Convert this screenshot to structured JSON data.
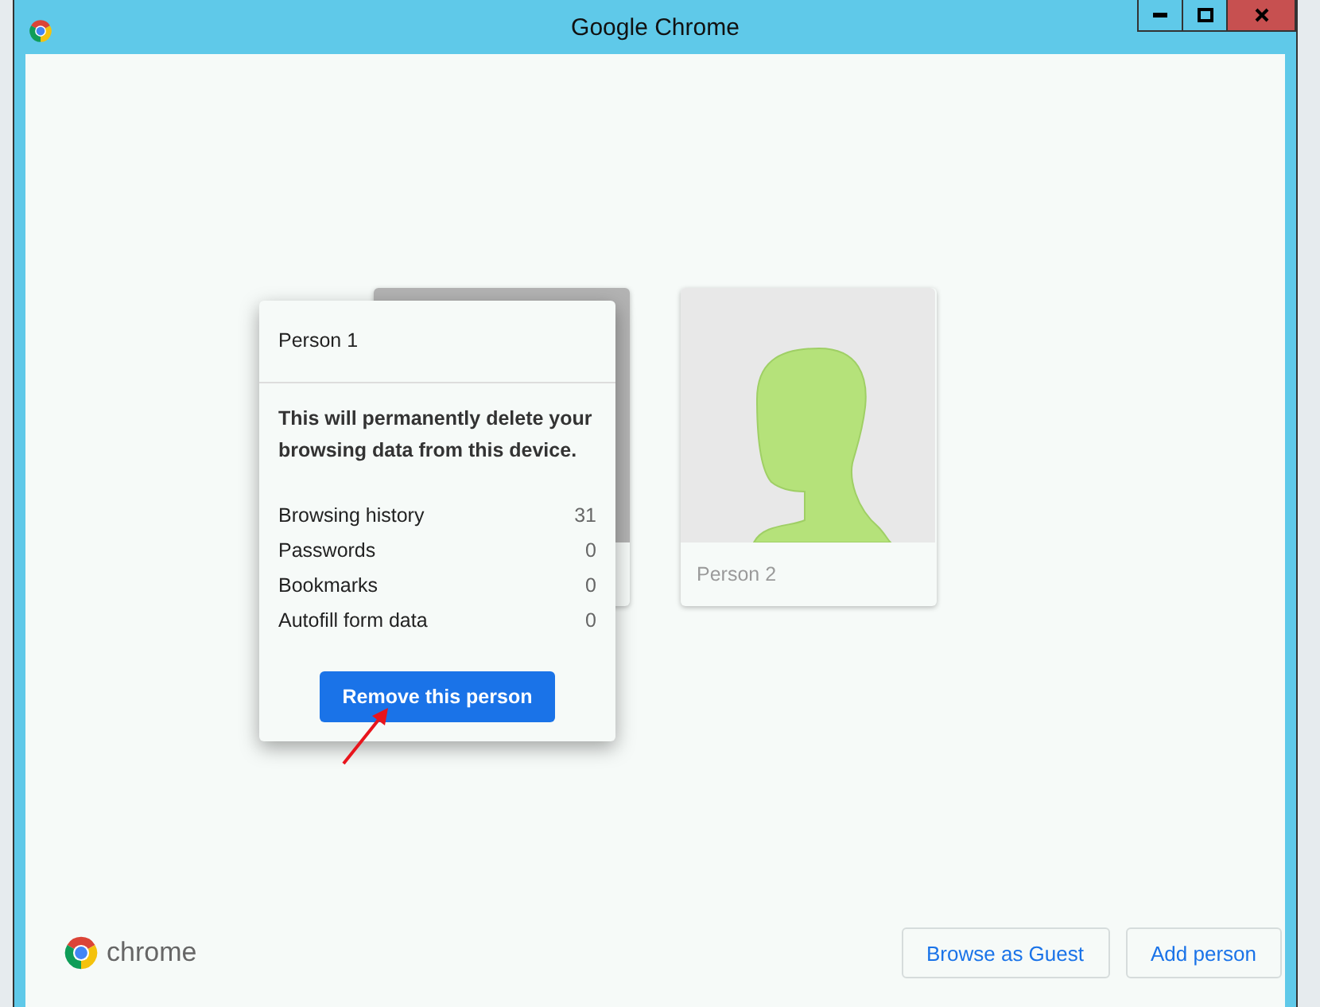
{
  "window": {
    "title": "Google Chrome"
  },
  "profiles": [
    {
      "kind": "dimmed"
    },
    {
      "kind": "avatar",
      "name": "Person 2"
    }
  ],
  "popup": {
    "title": "Person 1",
    "message": "This will permanently delete your browsing data from this device.",
    "stats": [
      {
        "label": "Browsing history",
        "count": "31"
      },
      {
        "label": "Passwords",
        "count": "0"
      },
      {
        "label": "Bookmarks",
        "count": "0"
      },
      {
        "label": "Autofill form data",
        "count": "0"
      }
    ],
    "button": "Remove this person"
  },
  "footer": {
    "brand": "chrome",
    "buttons": [
      "Browse as Guest",
      "Add person"
    ]
  }
}
